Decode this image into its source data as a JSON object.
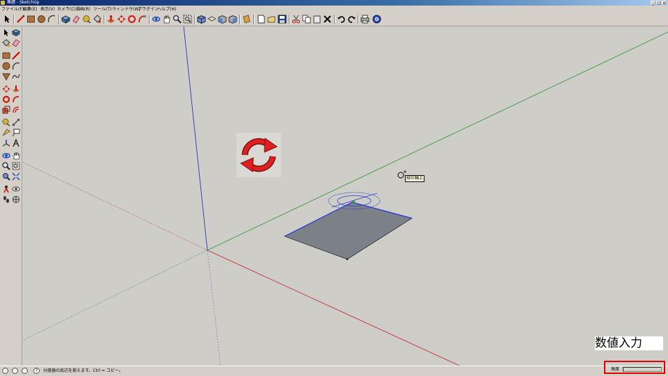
{
  "window": {
    "title": "無題 - SketchUp",
    "controls": [
      "_",
      "□",
      "×"
    ]
  },
  "menu": [
    "ファイル(F)",
    "編集(E)",
    "表示(V)",
    "カメラ(C)",
    "描画(R)",
    "ツール(T)",
    "ウィンドウ(W)",
    "プラグイン",
    "ヘルプ(H)"
  ],
  "toolbar_icons": [
    "select-icon",
    "line-icon",
    "rectangle-icon",
    "circle-icon",
    "arc-icon",
    "make-component-icon",
    "eraser-icon",
    "tape-measure-icon",
    "paint-bucket-icon",
    "push-pull-icon",
    "move-icon",
    "rotate-icon",
    "follow-me-icon",
    "scale-icon",
    "offset-icon",
    "orbit-icon",
    "pan-icon",
    "zoom-icon",
    "zoom-extents-icon",
    "iso-view-icon",
    "top-view-icon",
    "front-view-icon",
    "right-view-icon",
    "back-view-icon",
    "left-view-icon",
    "new-icon",
    "open-icon",
    "save-icon",
    "cut-icon",
    "copy-icon",
    "paste-icon",
    "delete-icon",
    "undo-icon",
    "redo-icon",
    "print-icon",
    "model-info-icon"
  ],
  "viewport": {
    "tooltip": "緑の軸上",
    "numeric_overlay": "数値入力",
    "axis_colors": {
      "red": "#c04040",
      "green": "#3a9a3a",
      "blue": "#3030c0"
    },
    "face_color": "#7c8187"
  },
  "statusbar": {
    "hint": "分度器の底辺を揃えます。Ctrl = コピー。",
    "vcb_label": "角度",
    "vcb_value": ""
  }
}
